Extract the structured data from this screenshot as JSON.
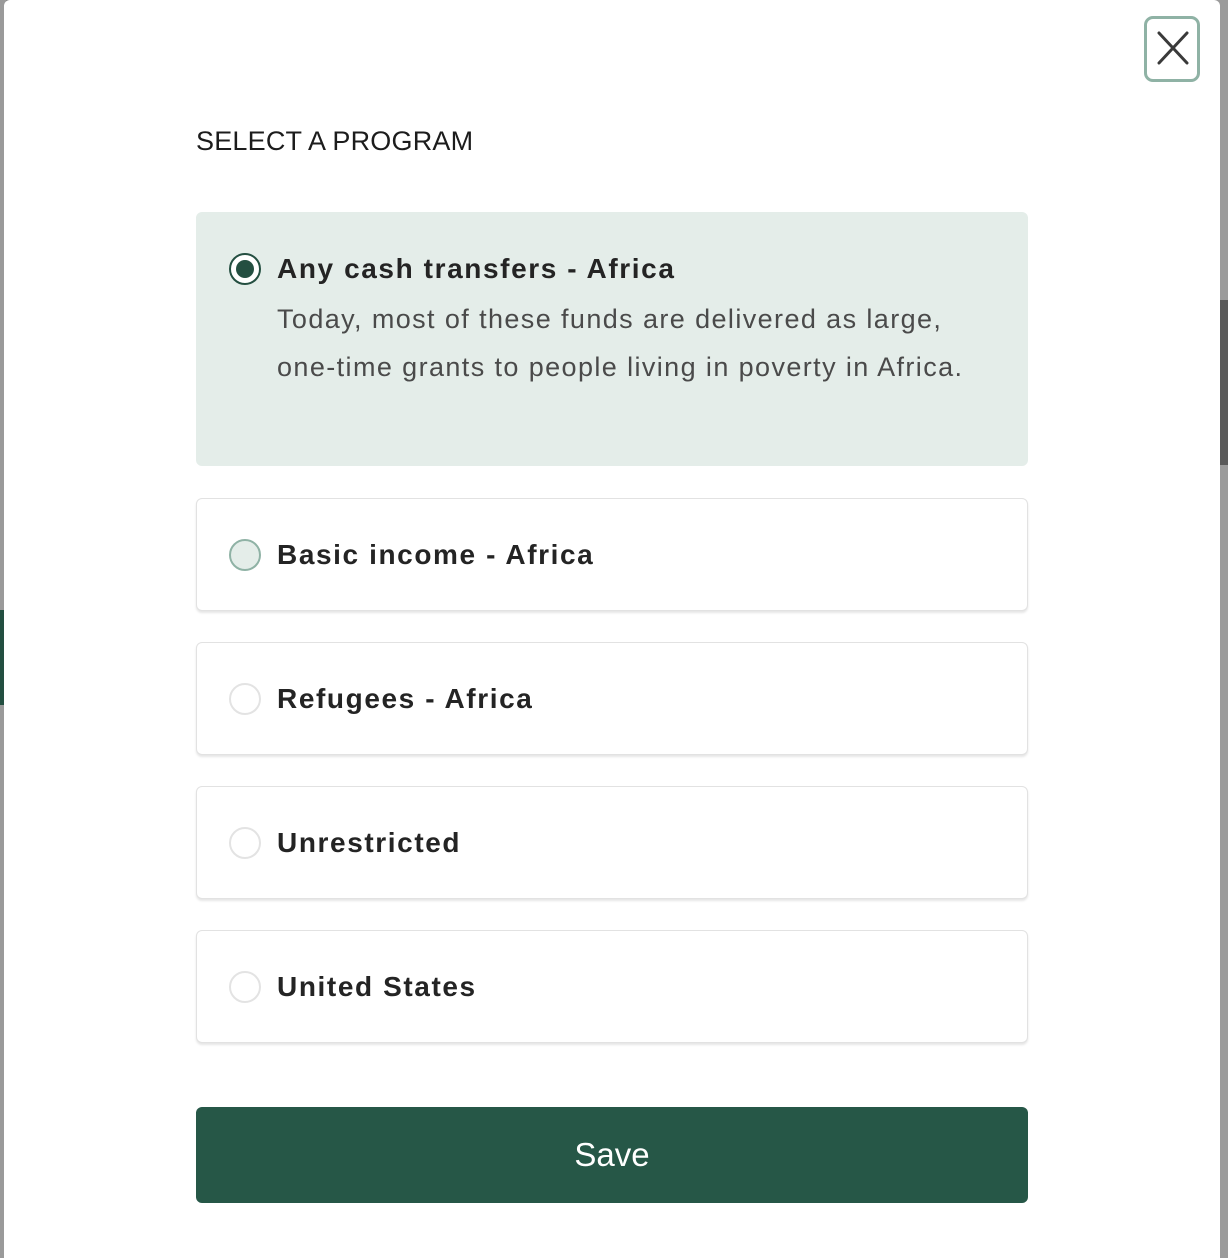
{
  "dialog": {
    "title": "SELECT A PROGRAM",
    "close_icon": "close-icon",
    "save_label": "Save"
  },
  "options": [
    {
      "label": "Any cash transfers - Africa",
      "description": "Today, most of these funds are delivered as large, one-time grants to people living in poverty in Africa.",
      "selected": true
    },
    {
      "label": "Basic income - Africa",
      "selected": false
    },
    {
      "label": "Refugees - Africa",
      "selected": false
    },
    {
      "label": "Unrestricted",
      "selected": false
    },
    {
      "label": "United States",
      "selected": false
    }
  ],
  "colors": {
    "accent": "#265747",
    "selected_bg": "#e4ede9",
    "close_border": "#8fb2a5"
  }
}
